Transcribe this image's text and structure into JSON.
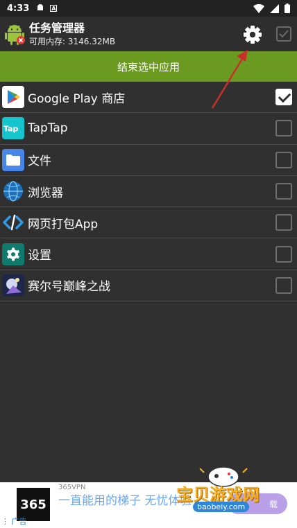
{
  "status_bar": {
    "time": "4:33"
  },
  "app": {
    "title": "任务管理器",
    "memory": "可用内存: 3146.32MB"
  },
  "end_button": {
    "label": "结束选中应用"
  },
  "apps": [
    {
      "label": "Google Play 商店",
      "checked": true,
      "icon": "google-play-icon"
    },
    {
      "label": "TapTap",
      "checked": false,
      "icon": "taptap-icon"
    },
    {
      "label": "文件",
      "checked": false,
      "icon": "folder-icon"
    },
    {
      "label": "浏览器",
      "checked": false,
      "icon": "globe-icon"
    },
    {
      "label": "网页打包App",
      "checked": false,
      "icon": "code-icon"
    },
    {
      "label": "设置",
      "checked": false,
      "icon": "settings-icon"
    },
    {
      "label": "赛尔号巅峰之战",
      "checked": false,
      "icon": "game-icon"
    }
  ],
  "ad": {
    "brand": "365VPN",
    "logo_text": "365",
    "text": "一直能用的梯子 无忧体验",
    "mark": "广告",
    "button_suffix": "载"
  },
  "watermark": {
    "name": "宝贝游戏网",
    "url": "baobeiy.com"
  },
  "colors": {
    "accent_green": "#6a9a1f",
    "background": "#303030",
    "annotation_arrow": "#c9302c"
  }
}
